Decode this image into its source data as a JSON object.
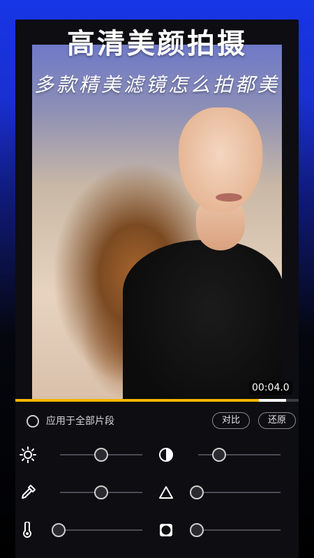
{
  "promo": {
    "title": "高清美颜拍摄",
    "subtitle": "多款精美滤镜怎么拍都美"
  },
  "preview": {
    "timecode": "00:04.0",
    "progress": 0.86
  },
  "options": {
    "apply_all_label": "应用于全部片段",
    "compare_label": "对比",
    "reset_label": "还原"
  },
  "adjustments": [
    {
      "name": "brightness",
      "icon": "sun-icon",
      "value": 0.5
    },
    {
      "name": "contrast",
      "icon": "half-circle-icon",
      "value": 0.25
    },
    {
      "name": "color-picker",
      "icon": "eyedropper-icon",
      "value": 0.5
    },
    {
      "name": "sharpen",
      "icon": "triangle-icon",
      "value": 0.05
    },
    {
      "name": "temperature",
      "icon": "thermometer-icon",
      "value": 0.05
    },
    {
      "name": "vignette",
      "icon": "vignette-icon",
      "value": 0.05
    }
  ],
  "colors": {
    "accent": "#f3b600",
    "background_top": "#1736e6"
  }
}
